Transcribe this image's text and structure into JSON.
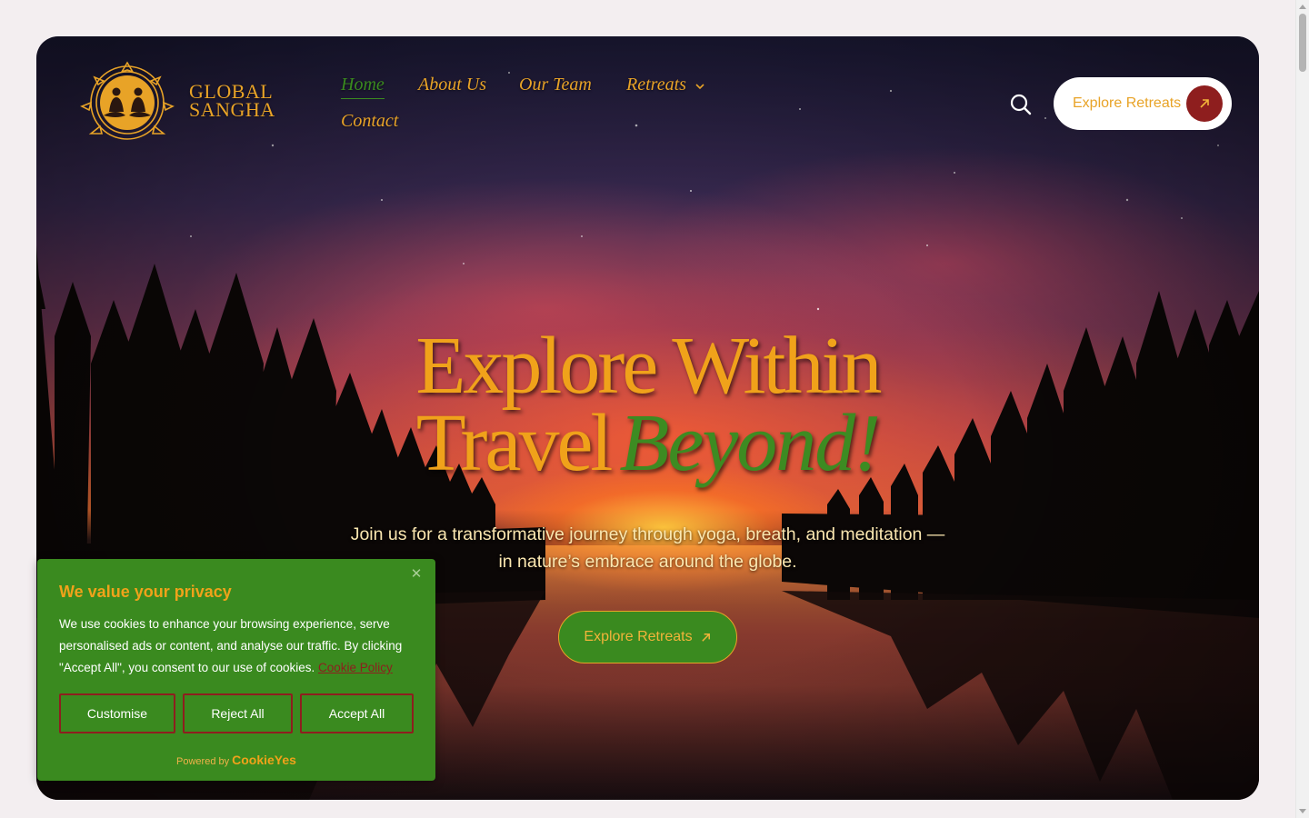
{
  "brand": {
    "line1": "GLOBAL",
    "line2": "SANGHA",
    "color": "#e8a327"
  },
  "nav": {
    "items": [
      {
        "label": "Home",
        "active": true
      },
      {
        "label": "About Us"
      },
      {
        "label": "Our Team"
      },
      {
        "label": "Retreats",
        "has_dropdown": true
      },
      {
        "label": "Contact"
      }
    ]
  },
  "header": {
    "search_icon": "search-icon",
    "cta_label": "Explore Retreats",
    "cta_icon": "arrow-up-right-icon"
  },
  "hero": {
    "headline_line1": "Explore Within",
    "headline_line2_plain": "Travel",
    "headline_line2_emph": "Beyond!",
    "subtext": "Join us for a transformative journey through yoga, breath, and meditation — in nature’s embrace around the globe.",
    "cta_label": "Explore Retreats"
  },
  "cookie_banner": {
    "title": "We value your privacy",
    "body": "We use cookies to enhance your browsing experience, serve personalised ads or content, and analyse our traffic. By clicking \"Accept All\", you consent to our use of cookies.",
    "policy_link": "Cookie Policy",
    "buttons": {
      "customise": "Customise",
      "reject": "Reject All",
      "accept": "Accept All"
    },
    "powered_by": "Powered by",
    "powered_brand": "CookieYes"
  },
  "colors": {
    "gold": "#e8a327",
    "green": "#3a8a1f",
    "maroon": "#8e1e1e",
    "page_bg": "#f3eef0"
  }
}
